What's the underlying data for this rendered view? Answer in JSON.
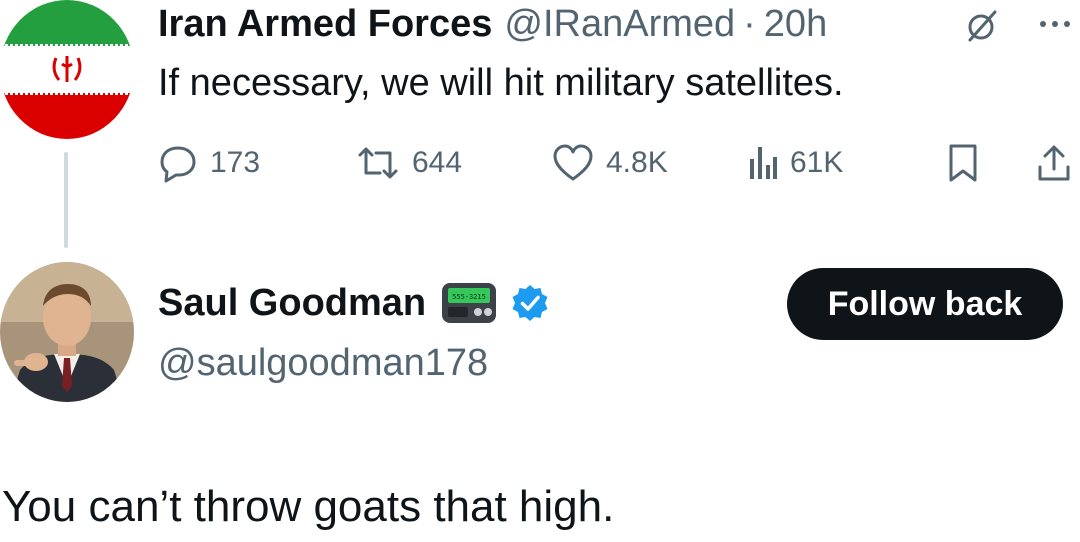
{
  "tweet": {
    "author_name": "Iran Armed Forces",
    "author_handle": "@IRanArmed",
    "separator": "·",
    "time": "20h",
    "text": "If necessary, we will hit military satellites.",
    "icons": {
      "avatar": "iran-flag-avatar",
      "grok": "grok-icon",
      "more": "more-icon",
      "reply": "reply-icon",
      "repost": "repost-icon",
      "like": "like-icon",
      "views": "views-icon",
      "bookmark": "bookmark-icon",
      "share": "share-icon"
    },
    "stats": {
      "replies": "173",
      "reposts": "644",
      "likes": "4.8K",
      "views": "61K"
    }
  },
  "profile_card": {
    "name": "Saul Goodman",
    "handle": "@saulgoodman178",
    "pager_text": "555-3215",
    "follow_button_label": "Follow back",
    "icons": {
      "avatar": "person-avatar",
      "pager": "pager-emoji-icon",
      "verified": "verified-badge-icon"
    }
  },
  "caption": "You can’t throw goats that high.",
  "colors": {
    "text_primary": "#0f1419",
    "text_secondary": "#536471",
    "verified_blue": "#1d9bf0",
    "flag_green": "#239f40",
    "flag_red": "#da0000",
    "button_bg": "#0f1419",
    "button_text": "#ffffff"
  }
}
